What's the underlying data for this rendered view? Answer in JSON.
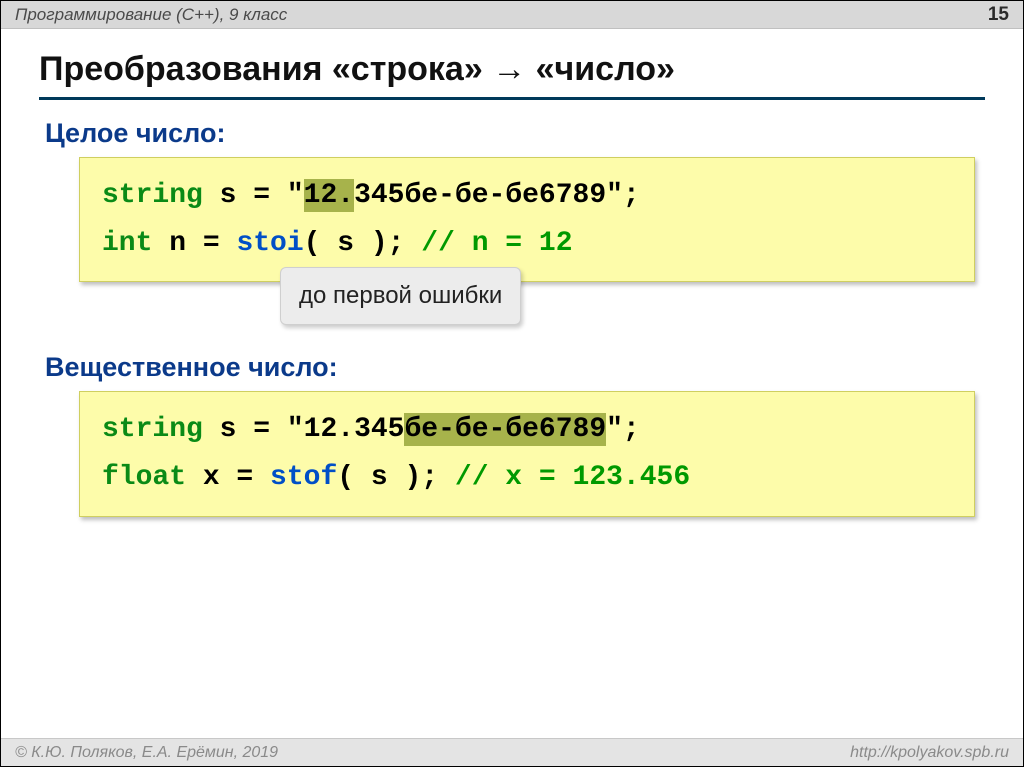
{
  "header": {
    "left": "Программирование (C++), 9 класс",
    "page": "15"
  },
  "title": {
    "pre": "Преобразования «строка» ",
    "arrow": "→",
    "post": " «число»"
  },
  "section1": {
    "heading": "Целое число:",
    "line1": {
      "type": "string",
      "var": " s = ",
      "q1": "\"",
      "hl": "12.",
      "rest": "345бе-бе-бе6789",
      "q2": "\";"
    },
    "line2": {
      "type": "int",
      "mid": " n = ",
      "func": "stoi",
      "args": "( s );",
      "pad": " ",
      "comment": "// n = 12"
    },
    "callout": "до первой ошибки"
  },
  "section2": {
    "heading": "Вещественное число:",
    "line1": {
      "type": "string",
      "var": " s = ",
      "q1": "\"",
      "plain": "12.345",
      "hl": "бе-бе-бе6789",
      "q2": "\";"
    },
    "line2": {
      "type": "float",
      "mid": " x = ",
      "func": "stof",
      "args": "( s );",
      "pad": " ",
      "comment": "// x = 123.456"
    }
  },
  "footer": {
    "left": "© К.Ю. Поляков, Е.А. Ерёмин, 2019",
    "right": "http://kpolyakov.spb.ru"
  }
}
